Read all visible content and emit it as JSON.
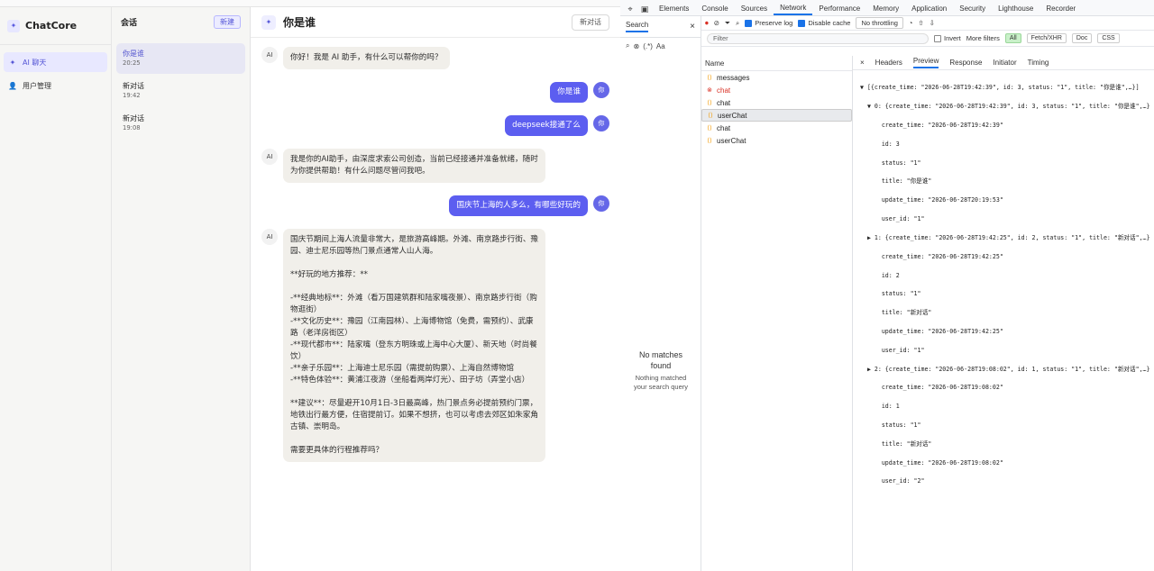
{
  "app": {
    "brand": "ChatCore",
    "nav": [
      {
        "label": "AI 聊天",
        "icon": "sparkle-icon"
      },
      {
        "label": "用户管理",
        "icon": "user-icon"
      }
    ],
    "sessions_title": "会话",
    "new_button": "新建",
    "sessions": [
      {
        "title": "你是谁",
        "time": "20:25"
      },
      {
        "title": "新对话",
        "time": "19:42"
      },
      {
        "title": "新对话",
        "time": "19:08"
      }
    ],
    "chat_title": "你是谁",
    "chat_button": "新对话",
    "messages": [
      {
        "role": "ai",
        "avatar": "AI",
        "text": "你好！我是 AI 助手，有什么可以帮你的吗？"
      },
      {
        "role": "user",
        "avatar": "你",
        "text": "你是谁"
      },
      {
        "role": "user",
        "avatar": "你",
        "text": "deepseek接通了么"
      },
      {
        "role": "ai",
        "avatar": "AI",
        "text": "我是你的AI助手，由深度求索公司创造，当前已经接通并准备就绪，随时\n为你提供帮助！有什么问题尽管问我吧。"
      },
      {
        "role": "user",
        "avatar": "你",
        "text": "国庆节上海的人多么，有哪些好玩的"
      },
      {
        "role": "ai",
        "avatar": "AI",
        "text": "国庆节期间上海人流量非常大，是旅游高峰期。外滩、南京路步行街、豫\n园、迪士尼乐园等热门景点通常人山人海。\n\n**好玩的地方推荐：**\n\n-**经典地标**：外滩（看万国建筑群和陆家嘴夜景）、南京路步行街（购\n物逛街）\n-**文化历史**：豫园（江南园林）、上海博物馆（免费，需预约）、武康\n路（老洋房街区）\n-**现代都市**：陆家嘴（登东方明珠或上海中心大厦）、新天地（时尚餐\n饮）\n-**亲子乐园**：上海迪士尼乐园（需提前购票）、上海自然博物馆\n-**特色体验**：黄浦江夜游（坐船看两岸灯光）、田子坊（弄堂小店）\n\n**建议**：尽量避开10月1日-3日最高峰，热门景点务必提前预约门票，\n地铁出行最方便，住宿提前订。如果不想挤，也可以考虑去郊区如朱家角\n古镇、崇明岛。\n\n需要更具体的行程推荐吗？"
      }
    ]
  },
  "devtools": {
    "main_tabs": [
      "Elements",
      "Console",
      "Sources",
      "Network",
      "Performance",
      "Memory",
      "Application",
      "Security",
      "Lighthouse",
      "Recorder"
    ],
    "active_tab": "Network",
    "search": {
      "title": "Search",
      "no_match_title": "No matches\nfound",
      "no_match_sub": "Nothing matched\nyour search query"
    },
    "toolbar": {
      "preserve_log": "Preserve log",
      "disable_cache": "Disable cache",
      "throttle": "No throttling"
    },
    "filter": {
      "placeholder": "Filter",
      "invert": "Invert",
      "more_filters": "More filters",
      "types": [
        "All",
        "Fetch/XHR",
        "Doc",
        "CSS"
      ]
    },
    "list": {
      "header": "Name",
      "requests": [
        {
          "name": "messages",
          "icon": "fetch-icon",
          "error": false,
          "selected": false
        },
        {
          "name": "chat",
          "icon": "error-icon",
          "error": true,
          "selected": false
        },
        {
          "name": "chat",
          "icon": "fetch-icon",
          "error": false,
          "selected": false
        },
        {
          "name": "userChat",
          "icon": "fetch-icon",
          "error": false,
          "selected": true
        },
        {
          "name": "chat",
          "icon": "fetch-icon",
          "error": false,
          "selected": false
        },
        {
          "name": "userChat",
          "icon": "fetch-icon",
          "error": false,
          "selected": false
        }
      ]
    },
    "detail_tabs": [
      "Headers",
      "Preview",
      "Response",
      "Initiator",
      "Timing"
    ],
    "active_detail_tab": "Preview",
    "preview_lines": [
      "▼ [{create_time: \"2026-06-28T19:42:39\", id: 3, status: \"1\", title: \"你是谁\",…}]",
      "  ▼ 0: {create_time: \"2026-06-28T19:42:39\", id: 3, status: \"1\", title: \"你是谁\",…}",
      "      create_time: \"2026-06-28T19:42:39\"",
      "      id: 3",
      "      status: \"1\"",
      "      title: \"你是谁\"",
      "      update_time: \"2026-06-28T20:19:53\"",
      "      user_id: \"1\"",
      "  ▶ 1: {create_time: \"2026-06-28T19:42:25\", id: 2, status: \"1\", title: \"新对话\",…}",
      "      create_time: \"2026-06-28T19:42:25\"",
      "      id: 2",
      "      status: \"1\"",
      "      title: \"新对话\"",
      "      update_time: \"2026-06-28T19:42:25\"",
      "      user_id: \"1\"",
      "  ▶ 2: {create_time: \"2026-06-28T19:08:02\", id: 1, status: \"1\", title: \"新对话\",…}",
      "      create_time: \"2026-06-28T19:08:02\"",
      "      id: 1",
      "      status: \"1\"",
      "      title: \"新对话\"",
      "      update_time: \"2026-06-28T19:08:02\"",
      "      user_id: \"2\""
    ]
  }
}
